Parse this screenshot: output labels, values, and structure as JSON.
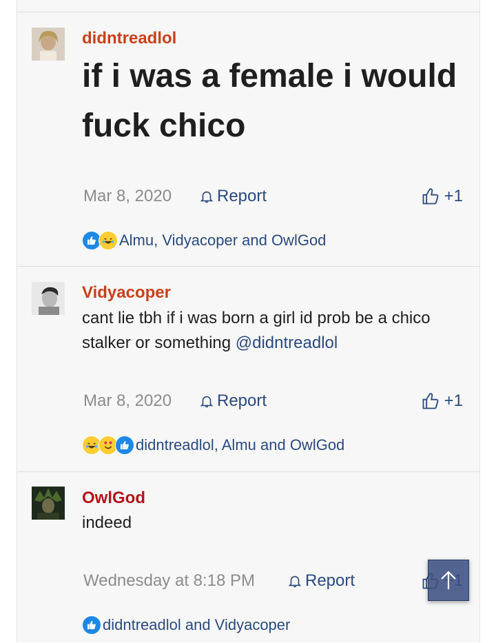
{
  "posts": [
    {
      "username": "didntreadlol",
      "username_color": "#c8401a",
      "message": "if i was a female i would fuck chico",
      "date": "Mar 8, 2020",
      "report_label": "Report",
      "like_label": "+1",
      "reactions_text": "Almu, Vidyacoper and OwlGod",
      "reaction_icons": [
        "like-reaction-icon",
        "laugh-reaction-icon"
      ]
    },
    {
      "username": "Vidyacoper",
      "username_color": "#c8401a",
      "message_text": "cant lie tbh if i was born a girl id prob be a chico stalker or something ",
      "mention": "@didntreadlol",
      "date": "Mar 8, 2020",
      "report_label": "Report",
      "like_label": "+1",
      "reactions_text": "didntreadlol, Almu and OwlGod",
      "reaction_icons": [
        "laugh-reaction-icon",
        "love-reaction-icon",
        "like-reaction-icon"
      ]
    },
    {
      "username": "OwlGod",
      "username_color": "#b3131b",
      "message": "indeed",
      "date": "Wednesday at 8:18 PM",
      "report_label": "Report",
      "like_label": "+1",
      "reactions_text": "didntreadlol and Vidyacoper",
      "reaction_icons": [
        "like-reaction-icon"
      ]
    }
  ],
  "colors": {
    "link": "#2a4a7f",
    "muted": "#8c8c8c",
    "card_bg": "#f7f7f7"
  }
}
